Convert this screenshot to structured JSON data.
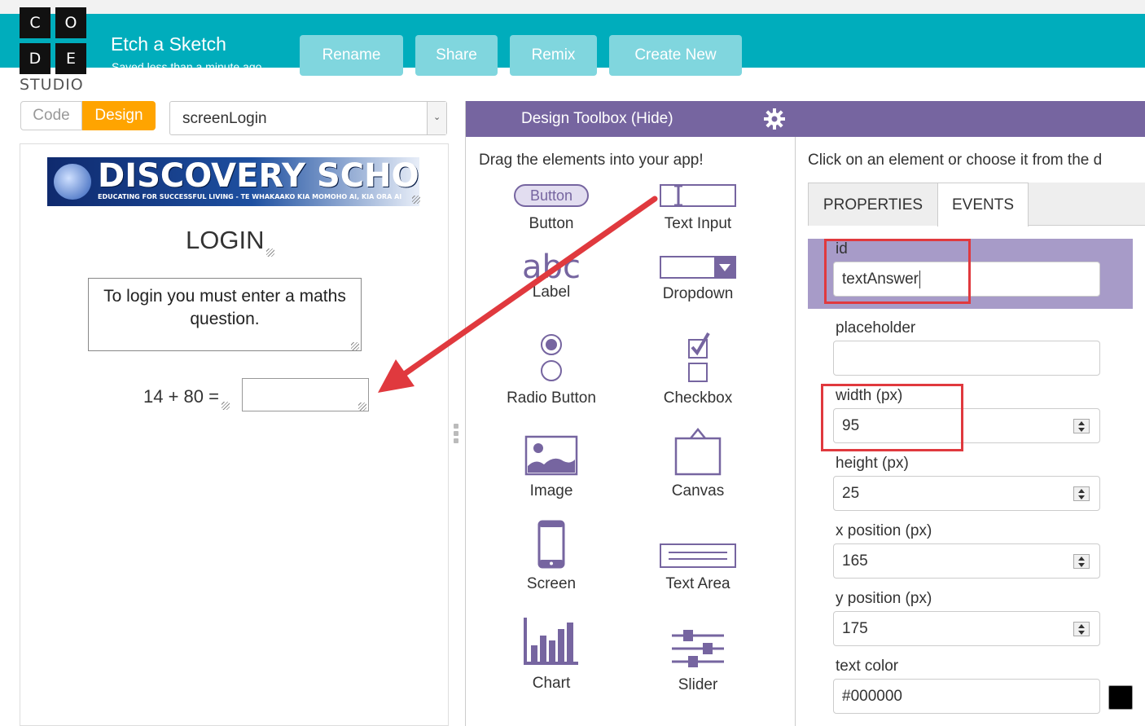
{
  "logo": {
    "letters": [
      "C",
      "O",
      "D",
      "E"
    ],
    "studio": "STUDIO"
  },
  "header": {
    "title": "Etch a Sketch",
    "saved": "Saved less than a minute ago",
    "buttons": {
      "rename": "Rename",
      "share": "Share",
      "remix": "Remix",
      "create_new": "Create New"
    }
  },
  "mode": {
    "code": "Code",
    "design": "Design"
  },
  "screen_select": {
    "value": "screenLogin"
  },
  "app_preview": {
    "banner_title": "DISCOVERY SCHOOL",
    "banner_subtitle": "EDUCATING FOR SUCCESSFUL LIVING - TE WHAKAAKO KIA MOMOHO AI, KIA ORA AI",
    "login_title": "LOGIN",
    "message": "To login you must enter a maths question.",
    "question": "14 + 80 ="
  },
  "toolbox": {
    "title": "Design Toolbox (Hide)",
    "hint": "Drag the elements into your app!",
    "button_sample": "Button",
    "label_sample": "abc",
    "items": {
      "button": "Button",
      "text_input": "Text Input",
      "label": "Label",
      "dropdown": "Dropdown",
      "radio": "Radio Button",
      "checkbox": "Checkbox",
      "image": "Image",
      "canvas": "Canvas",
      "screen": "Screen",
      "text_area": "Text Area",
      "chart": "Chart",
      "slider": "Slider"
    }
  },
  "properties": {
    "hint": "Click on an element or choose it from the d",
    "tabs": {
      "properties": "PROPERTIES",
      "events": "EVENTS"
    },
    "fields": {
      "id": {
        "label": "id",
        "value": "textAnswer"
      },
      "placeholder": {
        "label": "placeholder",
        "value": ""
      },
      "width": {
        "label": "width (px)",
        "value": "95"
      },
      "height": {
        "label": "height (px)",
        "value": "25"
      },
      "x": {
        "label": "x position (px)",
        "value": "165"
      },
      "y": {
        "label": "y position (px)",
        "value": "175"
      },
      "text_color": {
        "label": "text color",
        "value": "#000000"
      }
    }
  },
  "colors": {
    "header": "#00adbc",
    "header_button": "#80d6de",
    "design_active": "#ffa400",
    "toolbox_purple": "#7665a0",
    "icon_purple": "#7665a0",
    "highlight_red": "#e0393e",
    "text_color_swatch": "#000000"
  }
}
